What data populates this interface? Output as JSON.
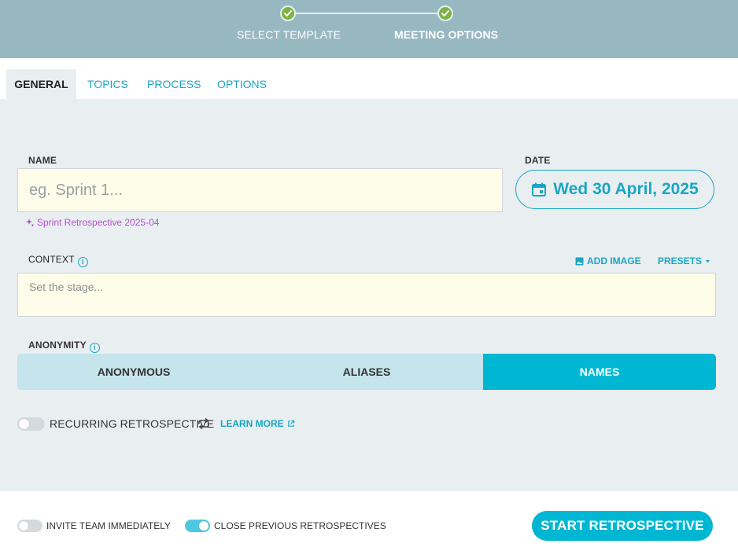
{
  "stepper": {
    "steps": [
      {
        "label": "SELECT TEMPLATE",
        "icon": "check-icon"
      },
      {
        "label": "MEETING OPTIONS",
        "icon": "check-icon"
      }
    ]
  },
  "tabs": [
    {
      "label": "GENERAL",
      "active": true
    },
    {
      "label": "TOPICS",
      "active": false
    },
    {
      "label": "PROCESS",
      "active": false
    },
    {
      "label": "OPTIONS",
      "active": false
    }
  ],
  "form": {
    "name_label": "NAME",
    "name_placeholder": "eg. Sprint 1...",
    "name_suggestion": "Sprint Retrospective 2025-04",
    "date_label": "DATE",
    "date_value": "Wed 30 April, 2025",
    "context_label": "CONTEXT",
    "add_image_label": "ADD IMAGE",
    "presets_label": "PRESETS",
    "context_placeholder": "Set the stage...",
    "anonymity_label": "ANONYMITY",
    "anonymity_options": [
      "ANONYMOUS",
      "ALIASES",
      "NAMES"
    ],
    "anonymity_selected": "NAMES",
    "recurring_label": "RECURRING RETROSPECTIVE",
    "learn_more_label": "LEARN MORE"
  },
  "footer": {
    "invite_label": "INVITE TEAM IMMEDIATELY",
    "invite_on": false,
    "close_previous_label": "CLOSE PREVIOUS RETROSPECTIVES",
    "close_previous_on": true,
    "start_button": "START RETROSPECTIVE"
  },
  "colors": {
    "accent": "#00b7d3",
    "link": "#1aa6c2",
    "header_bg": "#98b8c1",
    "step_done": "#7cb342",
    "suggestion": "#b453c7",
    "input_bg": "#fefde9",
    "panel_bg": "#e9eef1"
  }
}
